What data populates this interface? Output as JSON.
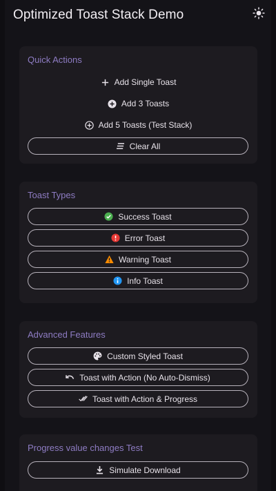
{
  "app": {
    "title": "Optimized Toast Stack Demo"
  },
  "sections": {
    "quick_actions": {
      "title": "Quick Actions",
      "add_single": "Add Single Toast",
      "add_three": "Add 3 Toasts",
      "add_five": "Add 5 Toasts (Test Stack)",
      "clear_all": "Clear All"
    },
    "toast_types": {
      "title": "Toast Types",
      "success": "Success Toast",
      "error": "Error Toast",
      "warning": "Warning Toast",
      "info": "Info Toast"
    },
    "advanced": {
      "title": "Advanced Features",
      "custom_styled": "Custom Styled Toast",
      "with_action": "Toast with Action (No Auto-Dismiss)",
      "action_progress": "Toast with Action & Progress"
    },
    "progress": {
      "title": "Progress value changes Test",
      "simulate_download": "Simulate Download"
    }
  },
  "icons": {
    "theme": "sun-icon",
    "add_single": "plus-icon",
    "add_three": "add-circle-icon",
    "add_five": "add-circle-outline-icon",
    "clear_all": "clear-all-icon",
    "success": "check-circle-icon",
    "error": "error-icon",
    "warning": "warning-icon",
    "info": "info-icon",
    "custom_styled": "palette-icon",
    "with_action": "undo-icon",
    "action_progress": "done-all-icon",
    "simulate_download": "download-icon"
  },
  "colors": {
    "accent": "#8e7cc3",
    "success": "#4caf50",
    "error": "#e53935",
    "warning": "#fb8c00",
    "info": "#2196f3",
    "card": "#1d1b20",
    "background": "#141318"
  }
}
